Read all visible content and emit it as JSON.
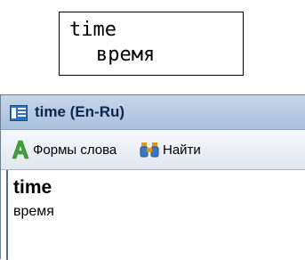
{
  "popup": {
    "word": "time",
    "translation": "время"
  },
  "window": {
    "title": "time (En-Ru)",
    "icon": "dictionary-icon",
    "toolbar": {
      "word_forms_label": "Формы слова",
      "word_forms_icon": "green-a-icon",
      "find_label": "Найти",
      "find_icon": "binoculars-icon"
    },
    "entry": {
      "headword": "time",
      "translation": "время"
    }
  },
  "colors": {
    "titlebar": "#b5c9e3",
    "title_text": "#0e2550",
    "toolbar": "#eaeef4"
  }
}
